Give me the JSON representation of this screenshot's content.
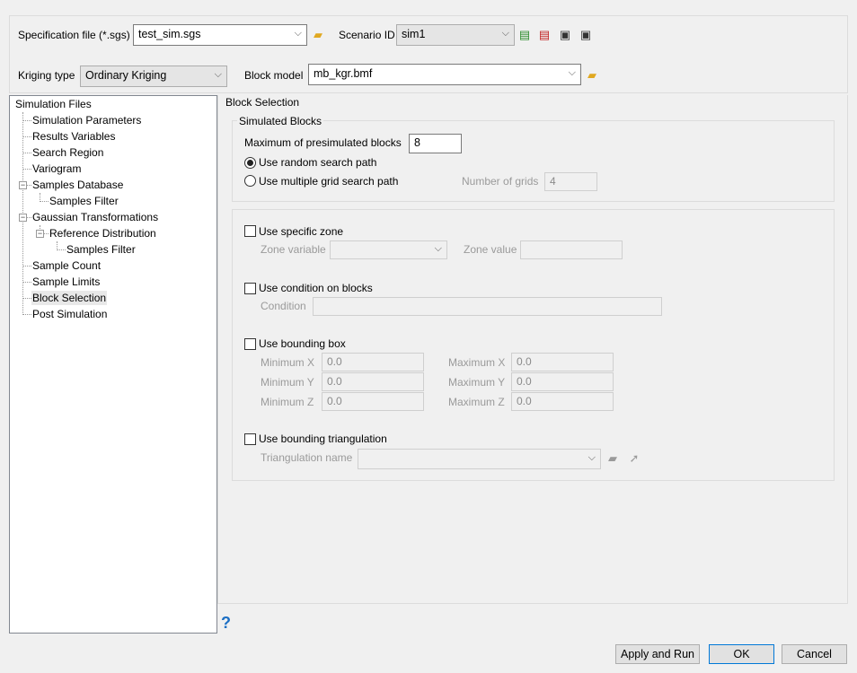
{
  "header": {
    "spec_label": "Specification file (*.sgs)",
    "spec_value": "test_sim.sgs",
    "scenario_label": "Scenario ID",
    "scenario_value": "sim1",
    "kriging_label": "Kriging type",
    "kriging_value": "Ordinary Kriging",
    "block_model_label": "Block model",
    "block_model_value": "mb_kgr.bmf"
  },
  "tree": [
    "Simulation Files",
    "Simulation Parameters",
    "Results Variables",
    "Search Region",
    "Variogram",
    "Samples Database",
    "Samples Filter",
    "Gaussian Transformations",
    "Reference Distribution",
    "Samples Filter",
    "Sample Count",
    "Sample Limits",
    "Block Selection",
    "Post Simulation"
  ],
  "panel": {
    "title": "Block Selection",
    "simulated_title": "Simulated Blocks",
    "max_label": "Maximum of presimulated blocks",
    "max_value": "8",
    "random_label": "Use random search path",
    "multi_label": "Use multiple grid search path",
    "grids_label": "Number of grids",
    "grids_value": "4",
    "zone_label": "Use specific zone",
    "zone_var_label": "Zone variable",
    "zone_value_label": "Zone value",
    "cond_label": "Use condition on blocks",
    "condition_label": "Condition",
    "bbox_label": "Use bounding box",
    "min_x": "Minimum X",
    "min_y": "Minimum Y",
    "min_z": "Minimum Z",
    "max_x": "Maximum X",
    "max_y": "Maximum Y",
    "max_z": "Maximum Z",
    "min_x_v": "0.0",
    "min_y_v": "0.0",
    "min_z_v": "0.0",
    "max_x_v": "0.0",
    "max_y_v": "0.0",
    "max_z_v": "0.0",
    "tri_label": "Use bounding triangulation",
    "tri_name_label": "Triangulation name"
  },
  "footer": {
    "help": "?",
    "apply": "Apply and Run",
    "ok": "OK",
    "cancel": "Cancel"
  }
}
